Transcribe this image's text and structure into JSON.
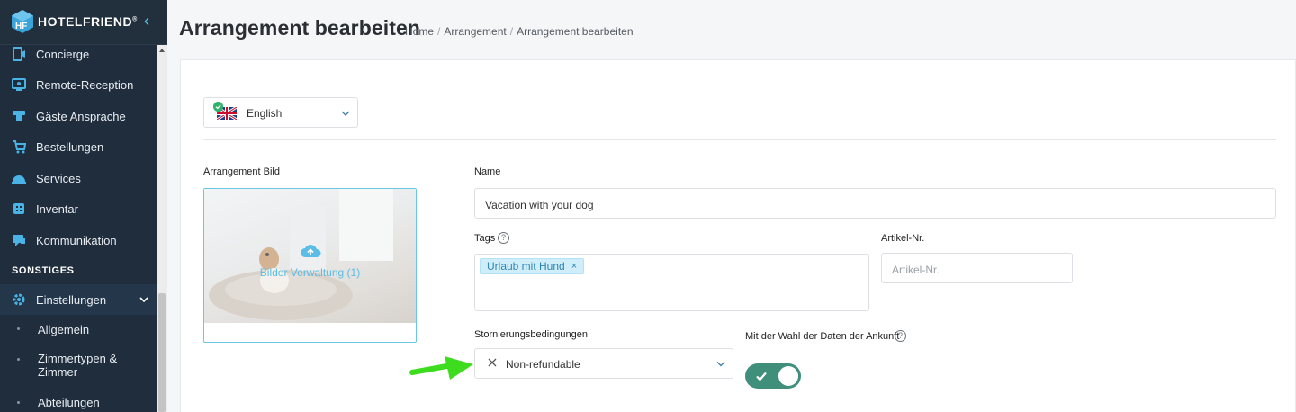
{
  "brand": {
    "name": "HOTELFRIEND",
    "trademark": "®"
  },
  "sidebar": {
    "items": [
      {
        "label": "Concierge",
        "icon": "concierge-icon"
      },
      {
        "label": "Remote-Reception",
        "icon": "remote-reception-icon"
      },
      {
        "label": "Gäste Ansprache",
        "icon": "guest-address-icon"
      },
      {
        "label": "Bestellungen",
        "icon": "cart-icon"
      },
      {
        "label": "Services",
        "icon": "services-icon"
      },
      {
        "label": "Inventar",
        "icon": "inventory-icon"
      },
      {
        "label": "Kommunikation",
        "icon": "communication-icon"
      }
    ],
    "section": "SONSTIGES",
    "settings": {
      "label": "Einstellungen",
      "icon": "gear-icon"
    },
    "sub_items": [
      "Allgemein",
      "Zimmertypen & Zimmer",
      "Abteilungen"
    ]
  },
  "header": {
    "title": "Arrangement bearbeiten",
    "breadcrumb": [
      "Home",
      "Arrangement",
      "Arrangement bearbeiten"
    ]
  },
  "language": {
    "selected": "English",
    "icon": "uk-flag-icon"
  },
  "form": {
    "image_label": "Arrangement Bild",
    "image_caption": "Bilder Verwaltung (1)",
    "name_label": "Name",
    "name_value": "Vacation with your dog",
    "tags_label": "Tags",
    "tags": [
      "Urlaub mit Hund"
    ],
    "article_label": "Artikel-Nr.",
    "article_placeholder": "Artikel-Nr.",
    "cancellation_label": "Stornierungsbedingungen",
    "cancellation_value": "Non-refundable",
    "arrival_label": "Mit der Wahl der Daten der Ankunft",
    "arrival_toggle_on": true
  },
  "colors": {
    "sidebar": "#1f2d3d",
    "accent": "#5dc1ea",
    "toggle": "#3f8f7a",
    "arrow": "#3ddc1f"
  }
}
